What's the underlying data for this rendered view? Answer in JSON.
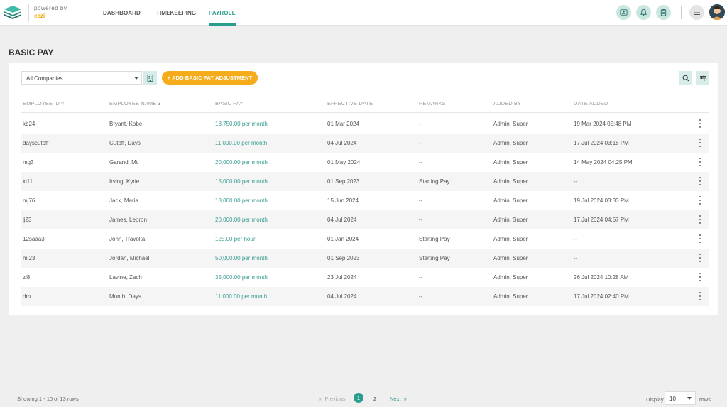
{
  "brand": {
    "powered_by": "powered by",
    "name": "eezi"
  },
  "nav": [
    {
      "label": "DASHBOARD",
      "active": false
    },
    {
      "label": "TIMEKEEPING",
      "active": false
    },
    {
      "label": "PAYROLL",
      "active": true
    }
  ],
  "header_icons": [
    "id-card-icon",
    "bell-icon",
    "clipboard-icon",
    "menu-icon",
    "avatar"
  ],
  "page": {
    "title": "BASIC PAY"
  },
  "toolbar": {
    "company_select": "All Companies",
    "add_button": "+ ADD BASIC PAY ADJUSTMENT"
  },
  "table": {
    "headers": {
      "employee_id": "EMPLOYEE ID",
      "employee_name": "EMPLOYEE NAME",
      "basic_pay": "BASIC PAY",
      "effective_date": "EFFECTIVE DATE",
      "remarks": "REMARKS",
      "added_by": "ADDED BY",
      "date_added": "DATE ADDED"
    },
    "rows": [
      {
        "id": "kb24",
        "name": "Bryant, Kobe",
        "pay": "18,750.00 per month",
        "effective": "01 Mar 2024",
        "remarks": "--",
        "added_by": "Admin, Super",
        "date_added": "19 Mar 2024 05:48 PM"
      },
      {
        "id": "dayscutoff",
        "name": "Cutoff, Days",
        "pay": "11,000.00 per month",
        "effective": "04 Jul 2024",
        "remarks": "--",
        "added_by": "Admin, Super",
        "date_added": "17 Jul 2024 03:18 PM"
      },
      {
        "id": "mg3",
        "name": "Garand, Mt",
        "pay": "20,000.00 per month",
        "effective": "01 May 2024",
        "remarks": "--",
        "added_by": "Admin, Super",
        "date_added": "14 May 2024 04:25 PM"
      },
      {
        "id": "ki11",
        "name": "Irving, Kyrie",
        "pay": "15,000.00 per month",
        "effective": "01 Sep 2023",
        "remarks": "Starting Pay",
        "added_by": "Admin, Super",
        "date_added": "--"
      },
      {
        "id": "mj76",
        "name": "Jack, Maria",
        "pay": "18,000.00 per month",
        "effective": "15 Jun 2024",
        "remarks": "--",
        "added_by": "Admin, Super",
        "date_added": "19 Jul 2024 03:33 PM"
      },
      {
        "id": "lj23",
        "name": "James, Lebron",
        "pay": "20,000.00 per month",
        "effective": "04 Jul 2024",
        "remarks": "--",
        "added_by": "Admin, Super",
        "date_added": "17 Jul 2024 04:57 PM"
      },
      {
        "id": "12saaa3",
        "name": "John, Travolta",
        "pay": "125.00 per hour",
        "effective": "01 Jan 2024",
        "remarks": "Starting Pay",
        "added_by": "Admin, Super",
        "date_added": "--"
      },
      {
        "id": "mj23",
        "name": "Jordan, Michael",
        "pay": "50,000.00 per month",
        "effective": "01 Sep 2023",
        "remarks": "Starting Pay",
        "added_by": "Admin, Super",
        "date_added": "--"
      },
      {
        "id": "zl8",
        "name": "Lavine, Zach",
        "pay": "35,000.00 per month",
        "effective": "23 Jul 2024",
        "remarks": "--",
        "added_by": "Admin, Super",
        "date_added": "26 Jul 2024 10:28 AM"
      },
      {
        "id": "dm",
        "name": "Month, Days",
        "pay": "11,000.00 per month",
        "effective": "04 Jul 2024",
        "remarks": "--",
        "added_by": "Admin, Super",
        "date_added": "17 Jul 2024 02:40 PM"
      }
    ]
  },
  "footer": {
    "showing": "Showing 1 - 10 of 13 rows",
    "previous": "Previous",
    "pages": [
      "1",
      "2"
    ],
    "current_page": "1",
    "next": "Next",
    "display_label": "Display",
    "display_value": "10",
    "rows_label": "rows"
  },
  "colors": {
    "accent": "#2a9d8f",
    "button": "#f5ac1a",
    "icon_bg": "#c9e6e1"
  }
}
